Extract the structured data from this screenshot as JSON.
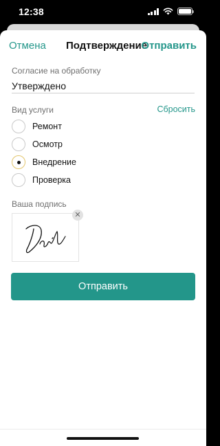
{
  "status_bar": {
    "time": "12:38"
  },
  "nav": {
    "cancel_label": "Отмена",
    "title": "Подтверждение",
    "send_label": "Отправить"
  },
  "consent": {
    "label": "Согласие на обработку",
    "value": "Утверждено"
  },
  "service": {
    "label": "Вид услуги",
    "reset_label": "Сбросить",
    "options": [
      "Ремонт",
      "Осмотр",
      "Внедрение",
      "Проверка"
    ],
    "selected": "Внедрение"
  },
  "signature": {
    "label": "Ваша подпись",
    "clear_icon": "close-icon",
    "clear_glyph": "✕"
  },
  "submit_label": "Отправить",
  "colors": {
    "accent": "#23968a",
    "radio_selected_ring": "#e2c46a"
  }
}
